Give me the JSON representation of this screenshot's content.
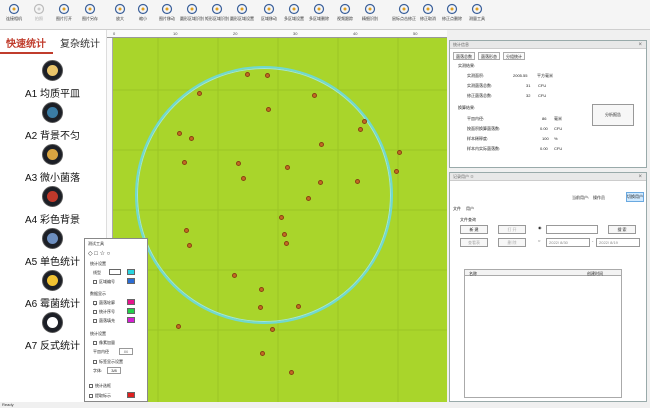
{
  "toolbar": {
    "items": [
      {
        "label": "连接相机",
        "icon": "camera-icon",
        "disabled": false
      },
      {
        "label": "拍照",
        "icon": "capture-icon",
        "disabled": true
      },
      {
        "label": "图片打开",
        "icon": "folder-open-icon",
        "disabled": false
      },
      {
        "label": "图片另存",
        "icon": "save-icon",
        "disabled": false
      },
      {
        "label": "放大",
        "icon": "zoom-in-icon",
        "disabled": false
      },
      {
        "label": "缩小",
        "icon": "zoom-out-icon",
        "disabled": false
      },
      {
        "label": "图片移动",
        "icon": "move-icon",
        "disabled": false
      },
      {
        "label": "圆形区域识别",
        "icon": "circle-region-icon",
        "disabled": false
      },
      {
        "label": "矩形区域识别",
        "icon": "rect-region-icon",
        "disabled": false
      },
      {
        "label": "圆形区域设置",
        "icon": "circle-set-icon",
        "disabled": false
      },
      {
        "label": "区域移动",
        "icon": "region-move-icon",
        "disabled": false
      },
      {
        "label": "多区域设置",
        "icon": "multi-region-icon",
        "disabled": false
      },
      {
        "label": "多区域删除",
        "icon": "multi-delete-icon",
        "disabled": false
      },
      {
        "label": "视频跟踪",
        "icon": "video-icon",
        "disabled": false
      },
      {
        "label": "精细识别",
        "icon": "fine-detect-icon",
        "disabled": false
      },
      {
        "label": "鼠标点击修正",
        "icon": "mouse-icon",
        "disabled": false
      },
      {
        "label": "修正取消",
        "icon": "undo-icon",
        "disabled": false
      },
      {
        "label": "修正点删除",
        "icon": "point-delete-icon",
        "disabled": false
      },
      {
        "label": "测量工具",
        "icon": "ruler-icon",
        "disabled": false
      }
    ]
  },
  "left_panel": {
    "tab_quick": "快速统计",
    "tab_complex": "复杂统计",
    "modes": [
      {
        "label": "A1 均质平皿",
        "icon": "uniform-dish-icon",
        "color": "#e9c46a"
      },
      {
        "label": "A2 背景不匀",
        "icon": "uneven-bg-icon",
        "color": "#3a7ca5"
      },
      {
        "label": "A3 微小菌落",
        "icon": "tiny-colony-icon",
        "color": "#d9a441"
      },
      {
        "label": "A4 彩色背景",
        "icon": "color-bg-icon",
        "color": "#c0392b"
      },
      {
        "label": "A5 单色统计",
        "icon": "mono-stat-icon",
        "color": "#6c8ebf"
      },
      {
        "label": "A6 霉菌统计",
        "icon": "mold-stat-icon",
        "color": "#f1c232"
      },
      {
        "label": "A7 反式统计",
        "icon": "reverse-stat-icon",
        "color": "#ffffff"
      }
    ]
  },
  "ruler": {
    "ticks": [
      "0",
      "10",
      "20",
      "30",
      "40",
      "50"
    ]
  },
  "stats_window": {
    "title": "统计信息",
    "tabs": [
      "菌落总数",
      "菌落形态",
      "分组统计"
    ],
    "section_detect": "实测结果:",
    "area_label": "实测面积:",
    "area_value": "2005.55",
    "area_unit": "平方毫米",
    "detected_label": "实测菌落总数:",
    "detected_value": "31",
    "detected_unit": "CFU",
    "corrected_label": "修正菌落总数:",
    "corrected_value": "32",
    "corrected_unit": "CFU",
    "section_convert": "换算结果:",
    "diameter_label": "平皿内径:",
    "diameter_value": "86",
    "diameter_unit": "毫米",
    "converted_label": "按面积换算菌落数:",
    "converted_value": "0.00",
    "converted_unit": "CFU",
    "ratio_label": "样本稀释度:",
    "ratio_value": "100",
    "ratio_unit": "%",
    "sample_label": "样本内实际菌落数:",
    "sample_value": "0.00",
    "sample_unit": "CFU",
    "report_button": "分析报告"
  },
  "records_window": {
    "title": "记录用户",
    "pin": "ㅁ",
    "current_user_label": "当前用户:",
    "current_user_value": "操作员",
    "switch_user_button": "切换用户",
    "menu_file": "文件",
    "menu_user": "用户",
    "group_query": "文件查询",
    "new_button": "新 建",
    "open_button": "打 开",
    "search_button": "搜 索",
    "query_button": "查看表",
    "delete_button": "删 除",
    "date_from": "2022/ 8/30",
    "date_to": "2022/ 8/19",
    "col_name": "名称",
    "col_time": "创建时间"
  },
  "tools_panel": {
    "title": "测试工具",
    "section_settings": "统计设置",
    "color_label": "线型",
    "show_region_label": "区域编号",
    "section_display": "数据显示",
    "show_outline": "菌落轮廓",
    "show_index": "统计序号",
    "show_fill": "菌落填充",
    "section_stats": "统计设置",
    "min_area": "像素加量",
    "diameter_label": "平皿内径",
    "diameter_value": "86",
    "label_setting": "标签显示设置",
    "font_size_label": "字体:",
    "font_size_value": "3/8",
    "stat_select": "统计选框",
    "picture_label": "提取标示",
    "colors": {
      "line": "#2ad4e0",
      "region": "#2b6cd4",
      "outline": "#e6148c",
      "index": "#22d04a",
      "fill": "#d61ed4",
      "picture": "#e02020"
    }
  },
  "status": "Ready"
}
